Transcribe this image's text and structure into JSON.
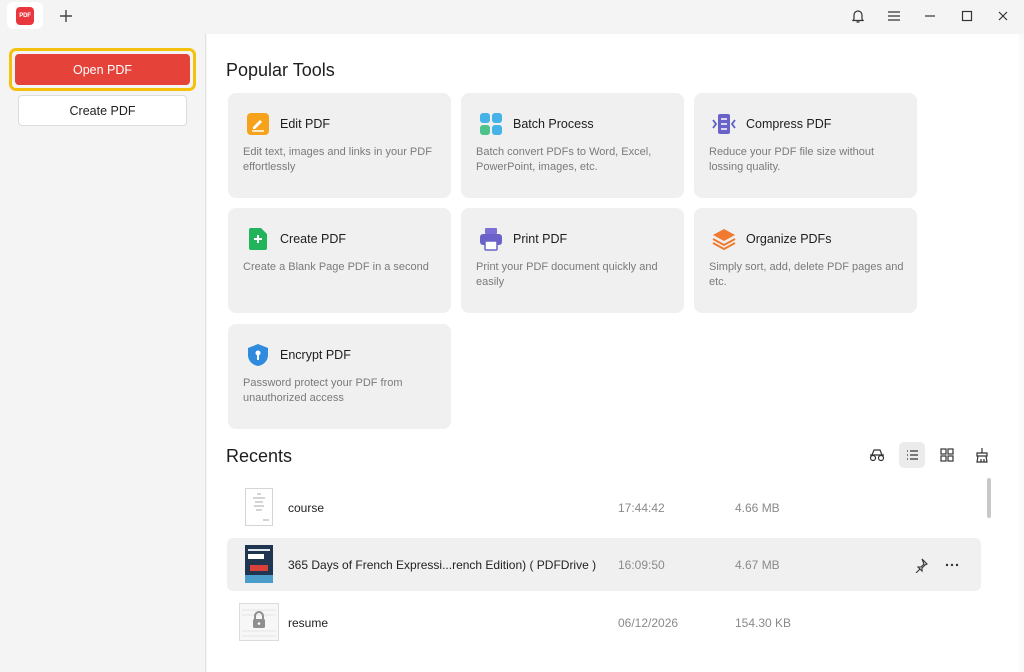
{
  "app": {
    "logo_text": "PDF"
  },
  "sidebar": {
    "open_label": "Open PDF",
    "create_label": "Create PDF"
  },
  "popular": {
    "title": "Popular Tools",
    "tools": [
      {
        "title": "Edit PDF",
        "desc": "Edit text, images and links in your PDF effortlessly",
        "icon": "edit-icon"
      },
      {
        "title": "Batch Process",
        "desc": "Batch convert PDFs to Word, Excel, PowerPoint, images, etc.",
        "icon": "batch-icon"
      },
      {
        "title": "Compress PDF",
        "desc": "Reduce your PDF file size without lossing quality.",
        "icon": "compress-icon"
      },
      {
        "title": "Create PDF",
        "desc": "Create a Blank Page PDF in a second",
        "icon": "plus-icon"
      },
      {
        "title": "Print PDF",
        "desc": "Print your PDF document quickly and easily",
        "icon": "printer-icon"
      },
      {
        "title": "Organize PDFs",
        "desc": "Simply sort, add, delete PDF pages and etc.",
        "icon": "layers-icon"
      },
      {
        "title": "Encrypt PDF",
        "desc": "Password protect your PDF from unauthorized access",
        "icon": "shield-icon"
      }
    ]
  },
  "recents": {
    "title": "Recents",
    "files": [
      {
        "name": "course",
        "date": "17:44:42",
        "size": "4.66 MB"
      },
      {
        "name": "365 Days of French Expressi...rench Edition) ( PDFDrive )",
        "date": "16:09:50",
        "size": "4.67 MB"
      },
      {
        "name": "resume",
        "date": "06/12/2026",
        "size": "154.30 KB"
      }
    ]
  },
  "colors": {
    "accent": "#e54339",
    "highlight": "#f4c20d"
  }
}
